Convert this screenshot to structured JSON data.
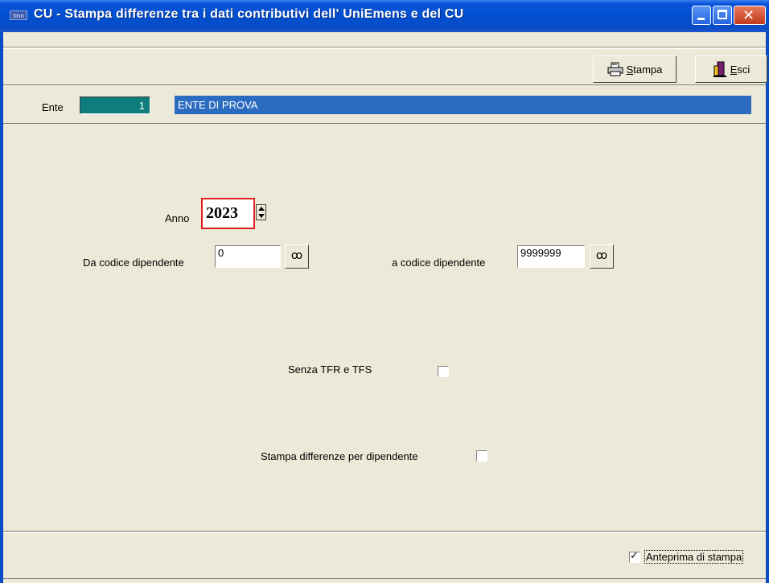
{
  "window": {
    "app_icon_text": "tinn",
    "title": "CU - Stampa differenze tra i dati contributivi dell' UniEmens e del CU"
  },
  "toolbar": {
    "stampa_label": "Stampa",
    "esci_label": "Esci"
  },
  "ente": {
    "label": "Ente",
    "code": "1",
    "name": "ENTE DI PROVA"
  },
  "form": {
    "anno_label": "Anno",
    "anno_value": "2023",
    "da_codice_label": "Da codice dipendente",
    "da_codice_value": "0",
    "a_codice_label": "a codice dipendente",
    "a_codice_value": "9999999",
    "senza_tfr_label": "Senza TFR e TFS",
    "senza_tfr_checked": false,
    "stampa_diff_label": "Stampa differenze per dipendente",
    "stampa_diff_checked": false
  },
  "footer": {
    "anteprima_label": "Anteprima di stampa",
    "anteprima_checked": true
  },
  "colors": {
    "titlebar": "#0050D0",
    "ente_code_bg": "#0F7D7D",
    "ente_name_bg": "#2C6CC0",
    "window_bg": "#ECE9D8",
    "highlight_border": "#E02020"
  }
}
